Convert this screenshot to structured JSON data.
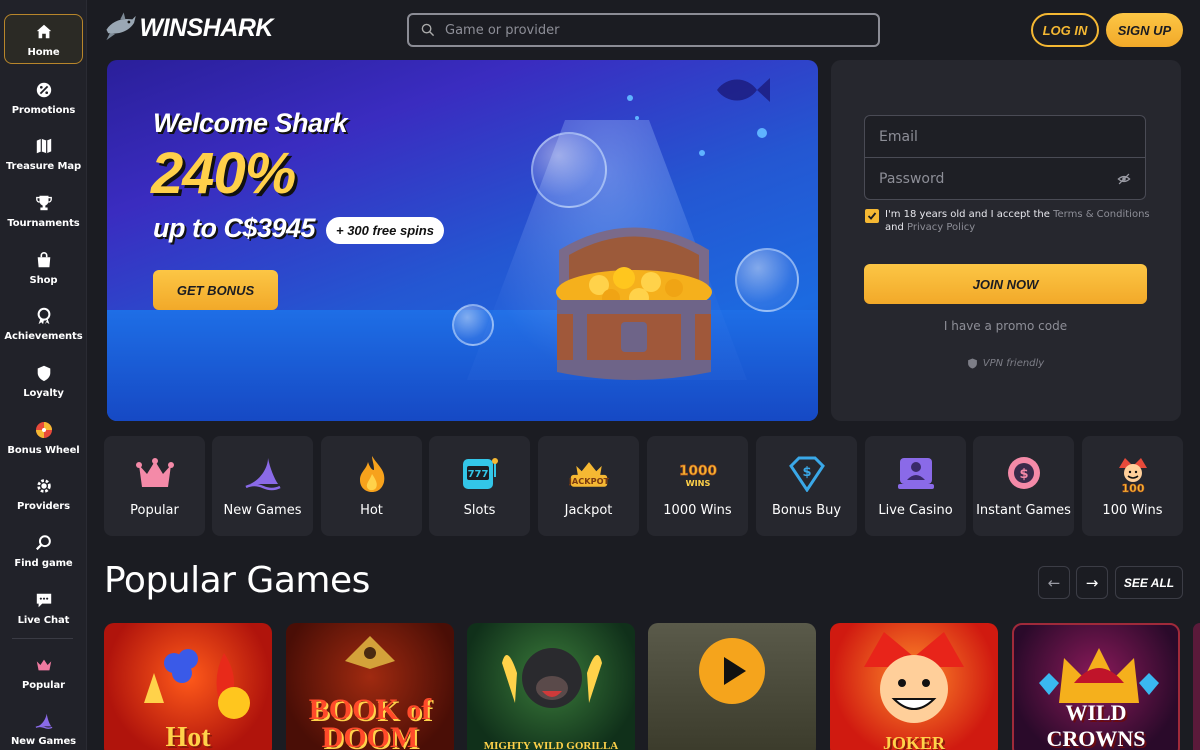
{
  "header": {
    "logo_text": "WINSHARK",
    "search_placeholder": "Game or provider",
    "login_label": "LOG IN",
    "signup_label": "SIGN UP"
  },
  "sidebar": {
    "items": [
      {
        "label": "Home",
        "icon": "home-icon"
      },
      {
        "label": "Promotions",
        "icon": "percent-icon"
      },
      {
        "label": "Treasure Map",
        "icon": "map-icon"
      },
      {
        "label": "Tournaments",
        "icon": "trophy-icon"
      },
      {
        "label": "Shop",
        "icon": "bag-icon"
      },
      {
        "label": "Achievements",
        "icon": "medal-icon"
      },
      {
        "label": "Loyalty",
        "icon": "crest-icon"
      },
      {
        "label": "Bonus Wheel",
        "icon": "wheel-icon"
      },
      {
        "label": "Providers",
        "icon": "gear-icon"
      },
      {
        "label": "Find game",
        "icon": "search-icon"
      },
      {
        "label": "Live Chat",
        "icon": "chat-icon"
      },
      {
        "label": "Popular",
        "icon": "crown-icon"
      },
      {
        "label": "New Games",
        "icon": "shark-fin-icon"
      }
    ]
  },
  "banner": {
    "title": "Welcome Shark",
    "percent": "240%",
    "up_to": "up to C$3945",
    "spins_badge": "+ 300 free spins",
    "cta": "GET BONUS"
  },
  "register": {
    "email_placeholder": "Email",
    "password_placeholder": "Password",
    "terms_prefix": "I'm 18 years old and I accept the ",
    "terms_link": "Terms & Conditions",
    "terms_and": " and ",
    "privacy_link": "Privacy Policy",
    "join_label": "JOIN NOW",
    "promo_label": "I have a promo code",
    "vpn_label": "VPN friendly"
  },
  "categories": [
    {
      "label": "Popular"
    },
    {
      "label": "New Games"
    },
    {
      "label": "Hot"
    },
    {
      "label": "Slots"
    },
    {
      "label": "Jackpot"
    },
    {
      "label": "1000 Wins"
    },
    {
      "label": "Bonus Buy"
    },
    {
      "label": "Live Casino"
    },
    {
      "label": "Instant Games"
    },
    {
      "label": "100 Wins"
    }
  ],
  "popular": {
    "title": "Popular Games",
    "prev_arrow": "←",
    "next_arrow": "→",
    "see_all": "SEE ALL",
    "games": [
      {
        "title": "Hot"
      },
      {
        "title": "BOOK of DOOM"
      },
      {
        "title": "MIGHTY WILD GORILLA"
      },
      {
        "title": ""
      },
      {
        "title": "JOKER"
      },
      {
        "title": "WILD CROWNS"
      }
    ]
  },
  "colors": {
    "accent": "#f5b833",
    "background": "#1b1c22",
    "panel": "#26272e"
  }
}
